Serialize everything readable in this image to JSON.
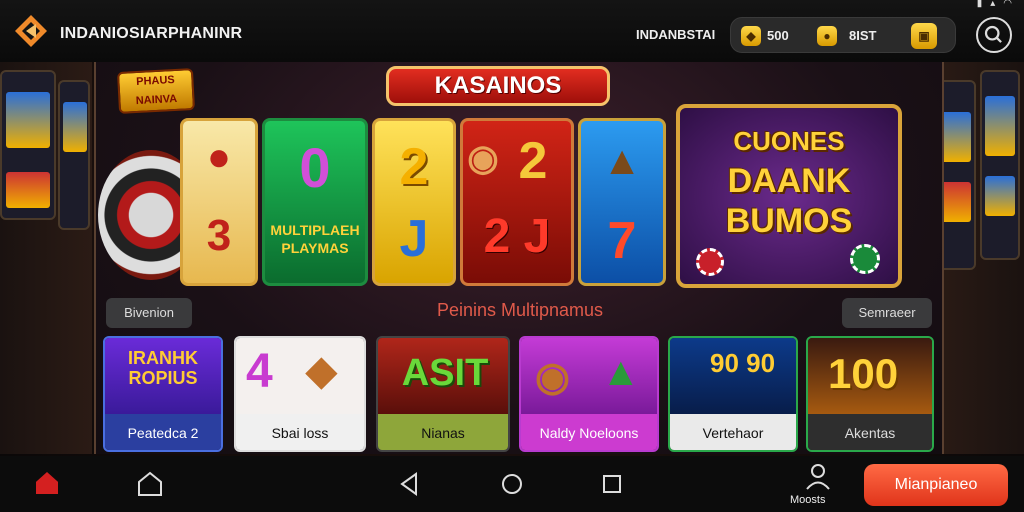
{
  "header": {
    "app_title": "INDANIOSIARPHANINR",
    "brand_right": "INDANBSTAI",
    "wallet": {
      "coins": "500",
      "gems": "8IST"
    },
    "status_icons": [
      "battery-icon",
      "signal-icon",
      "wifi-icon"
    ]
  },
  "hero": {
    "banner_title": "KASAINOS",
    "promo_badge": "PHAUS NAINVA",
    "reel_texts": {
      "r2_multi": "MULTIPLAEH PLAYMAS",
      "r2_top": "0",
      "r3_top": "2",
      "r3_bottom": "J",
      "r4_top": "2",
      "r4_bottom": "2 J",
      "r5_bottom": "7",
      "r1_bottom": "3"
    },
    "bonus_lines": [
      "CUONES",
      "DAANK",
      "BUMOS"
    ]
  },
  "section": {
    "left_button": "Bivenion",
    "title": "Peinins Multipnamus",
    "right_button": "Semraeer"
  },
  "games": [
    {
      "art_text": "IRANHK ROPIUS",
      "label": "Peatedca 2"
    },
    {
      "art_text": "4",
      "label": "Sbai loss"
    },
    {
      "art_text": "ASIT",
      "label": "Nianas"
    },
    {
      "art_text": "",
      "label": "Naldy Noeloons"
    },
    {
      "art_text": "90 90",
      "label": "Vertehaor"
    },
    {
      "art_text": "100",
      "label": "Akentas"
    }
  ],
  "bottom_nav": {
    "account_label": "Moosts",
    "cta_label": "Mianpianeo"
  },
  "colors": {
    "accent_red": "#e0341a",
    "gold": "#d9a43a",
    "banner_red": "#e22d20"
  }
}
